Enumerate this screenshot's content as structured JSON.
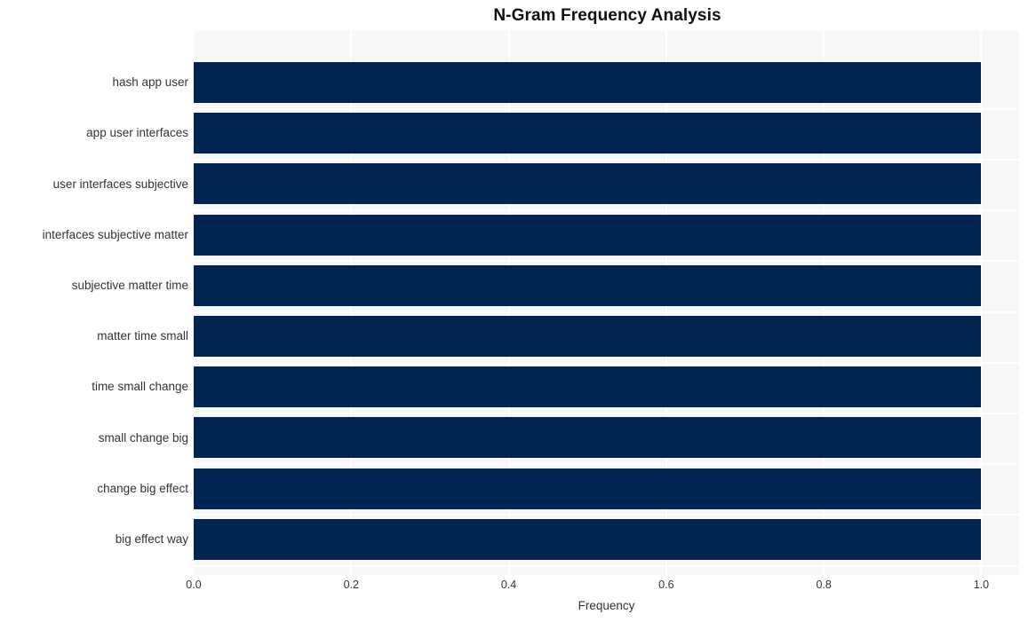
{
  "chart_data": {
    "type": "bar",
    "orientation": "horizontal",
    "title": "N-Gram Frequency Analysis",
    "xlabel": "Frequency",
    "ylabel": "",
    "categories": [
      "hash app user",
      "app user interfaces",
      "user interfaces subjective",
      "interfaces subjective matter",
      "subjective matter time",
      "matter time small",
      "time small change",
      "small change big",
      "change big effect",
      "big effect way"
    ],
    "values": [
      1.0,
      1.0,
      1.0,
      1.0,
      1.0,
      1.0,
      1.0,
      1.0,
      1.0,
      1.0
    ],
    "xticks": [
      "0.0",
      "0.2",
      "0.4",
      "0.6",
      "0.8",
      "1.0"
    ],
    "xtick_values": [
      0.0,
      0.2,
      0.4,
      0.6,
      0.8,
      1.0
    ],
    "xlim": [
      0.0,
      1.048
    ],
    "grid": true,
    "legend": false,
    "bar_color": "#022450",
    "plot_background": "#f7f7f7",
    "gridline_color": "#ffffff",
    "figure_background": "#ffffff",
    "text_color": "#333333",
    "title_color": "#111111"
  }
}
